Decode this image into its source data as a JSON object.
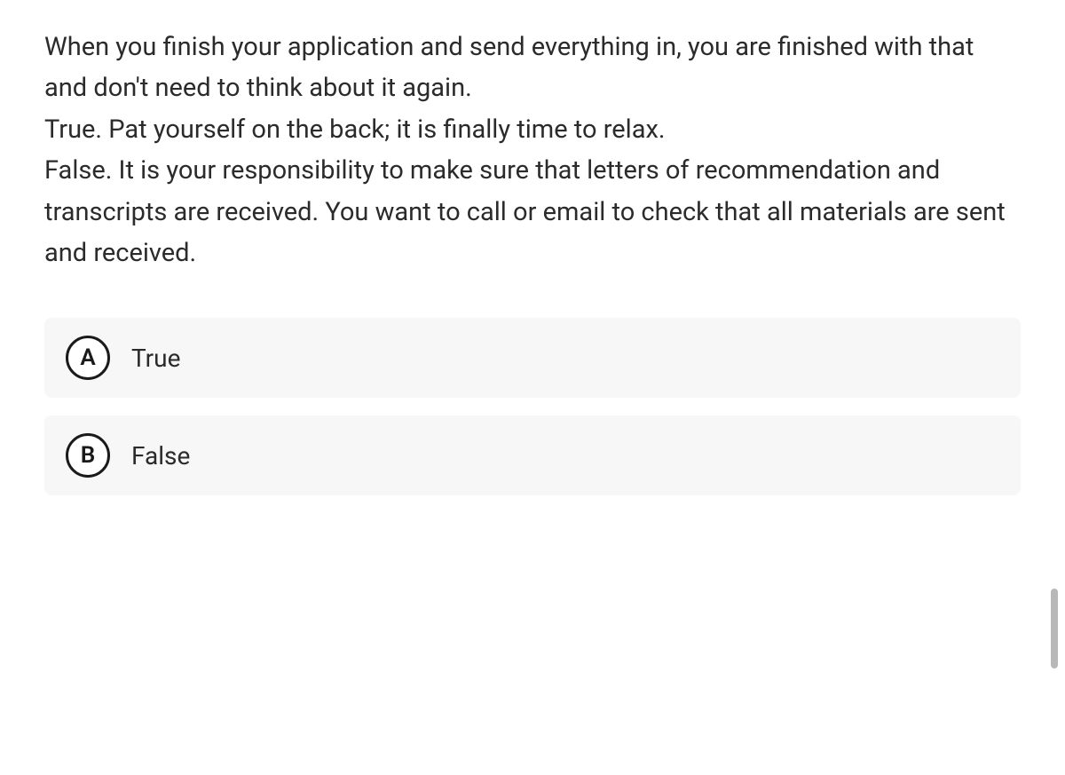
{
  "question": {
    "text": "When you finish your application and send everything in, you are finished with that and don't need to think about it again.\nTrue. Pat yourself on the back; it is finally time to relax.\nFalse. It is your responsibility to make sure that letters of recommendation and transcripts are received. You want to call or email to check that all materials are sent and received."
  },
  "options": [
    {
      "letter": "A",
      "label": "True"
    },
    {
      "letter": "B",
      "label": "False"
    }
  ]
}
